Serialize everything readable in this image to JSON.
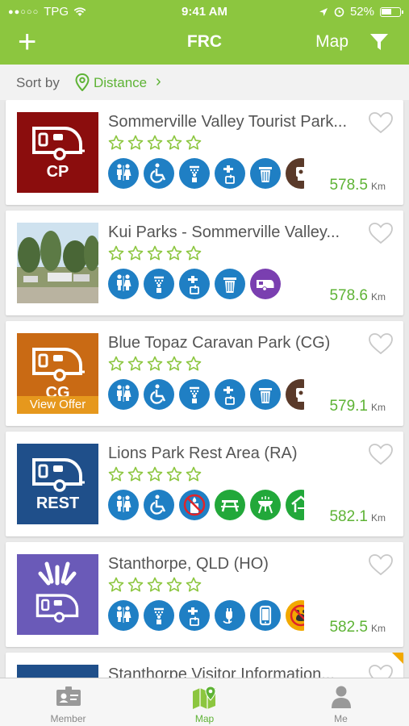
{
  "status": {
    "carrier": "TPG",
    "time": "9:41 AM",
    "battery": "52%"
  },
  "nav": {
    "title": "FRC",
    "map_label": "Map"
  },
  "sort": {
    "label": "Sort by",
    "value": "Distance"
  },
  "listings": [
    {
      "name": "Sommerville Valley Tourist Park...",
      "distance": "578.5",
      "unit": "Km",
      "thumb_color": "#8b0d0d",
      "thumb_label": "CP",
      "offer": "",
      "amenities": [
        {
          "icon": "toilets-icon",
          "color": "#1f7fc4"
        },
        {
          "icon": "wheelchair-icon",
          "color": "#1f7fc4"
        },
        {
          "icon": "shower-icon",
          "color": "#1f7fc4"
        },
        {
          "icon": "water-tap-icon",
          "color": "#1f7fc4"
        },
        {
          "icon": "rubbish-bin-icon",
          "color": "#1f7fc4"
        },
        {
          "icon": "dump-point-icon",
          "color": "#5a3a2a"
        }
      ]
    },
    {
      "name": "Kui Parks - Sommerville Valley...",
      "distance": "578.6",
      "unit": "Km",
      "thumb_color": "photo",
      "thumb_label": "",
      "offer": "",
      "amenities": [
        {
          "icon": "toilets-icon",
          "color": "#1f7fc4"
        },
        {
          "icon": "shower-icon",
          "color": "#1f7fc4"
        },
        {
          "icon": "water-tap-icon",
          "color": "#1f7fc4"
        },
        {
          "icon": "rubbish-bin-icon",
          "color": "#1f7fc4"
        },
        {
          "icon": "caravan-icon",
          "color": "#7a3fb0"
        }
      ]
    },
    {
      "name": "Blue Topaz Caravan Park (CG)",
      "distance": "579.1",
      "unit": "Km",
      "thumb_color": "#c96a14",
      "thumb_label": "CG",
      "offer": "View Offer",
      "amenities": [
        {
          "icon": "toilets-icon",
          "color": "#1f7fc4"
        },
        {
          "icon": "wheelchair-icon",
          "color": "#1f7fc4"
        },
        {
          "icon": "shower-icon",
          "color": "#1f7fc4"
        },
        {
          "icon": "water-tap-icon",
          "color": "#1f7fc4"
        },
        {
          "icon": "rubbish-bin-icon",
          "color": "#1f7fc4"
        },
        {
          "icon": "dump-point-icon",
          "color": "#5a3a2a"
        }
      ]
    },
    {
      "name": "Lions Park Rest Area (RA)",
      "distance": "582.1",
      "unit": "Km",
      "thumb_color": "#1f4f8a",
      "thumb_label": "REST",
      "offer": "",
      "amenities": [
        {
          "icon": "toilets-icon",
          "color": "#1f7fc4"
        },
        {
          "icon": "wheelchair-icon",
          "color": "#1f7fc4"
        },
        {
          "icon": "no-drinking-water-icon",
          "color": "#1f7fc4"
        },
        {
          "icon": "picnic-table-icon",
          "color": "#22a83a"
        },
        {
          "icon": "bbq-icon",
          "color": "#22a83a"
        },
        {
          "icon": "shelter-icon",
          "color": "#22a83a"
        }
      ]
    },
    {
      "name": "Stanthorpe, QLD (HO)",
      "distance": "582.5",
      "unit": "Km",
      "thumb_color": "#6a5ab8",
      "thumb_label": "",
      "offer": "",
      "amenities": [
        {
          "icon": "toilets-icon",
          "color": "#1f7fc4"
        },
        {
          "icon": "shower-icon",
          "color": "#1f7fc4"
        },
        {
          "icon": "water-tap-icon",
          "color": "#1f7fc4"
        },
        {
          "icon": "power-plug-icon",
          "color": "#1f7fc4"
        },
        {
          "icon": "phone-signal-icon",
          "color": "#1f7fc4"
        },
        {
          "icon": "no-pets-icon",
          "color": "#f2a900"
        }
      ]
    },
    {
      "name": "Stanthorpe Visitor Information...",
      "distance": "",
      "unit": "",
      "thumb_color": "#1f4f8a",
      "thumb_label": "",
      "offer": "",
      "amenities": []
    }
  ],
  "tabs": [
    {
      "label": "Member",
      "icon": "member-card-icon"
    },
    {
      "label": "Map",
      "icon": "map-icon"
    },
    {
      "label": "Me",
      "icon": "person-icon"
    }
  ],
  "colors": {
    "brand_green": "#8cc63f",
    "accent_green": "#5eb335"
  }
}
